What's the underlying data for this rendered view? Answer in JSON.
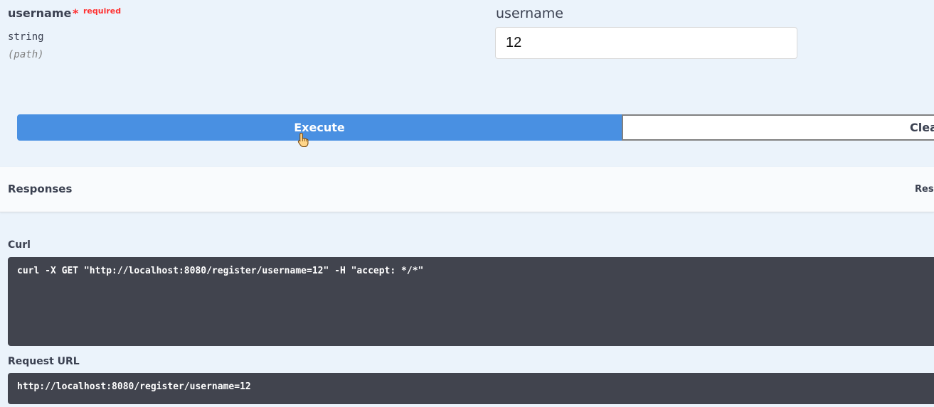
{
  "parameter": {
    "name": "username",
    "required_star": "*",
    "required_label": "required",
    "type": "string",
    "location": "(path)",
    "field_label": "username",
    "value": "12"
  },
  "actions": {
    "execute_label": "Execute",
    "clear_label": "Clear"
  },
  "responses": {
    "title": "Responses",
    "right_label": "Resp"
  },
  "curl": {
    "label": "Curl",
    "command": "curl -X GET \"http://localhost:8080/register/username=12\" -H \"accept: */*\""
  },
  "request_url": {
    "label": "Request URL",
    "value": "http://localhost:8080/register/username=12"
  },
  "colors": {
    "execute_button": "#4990e2",
    "required": "#ff3030",
    "code_background": "#41444e",
    "page_background": "#ebf3fb"
  },
  "icons": {
    "cursor": "hand-pointer-icon"
  }
}
